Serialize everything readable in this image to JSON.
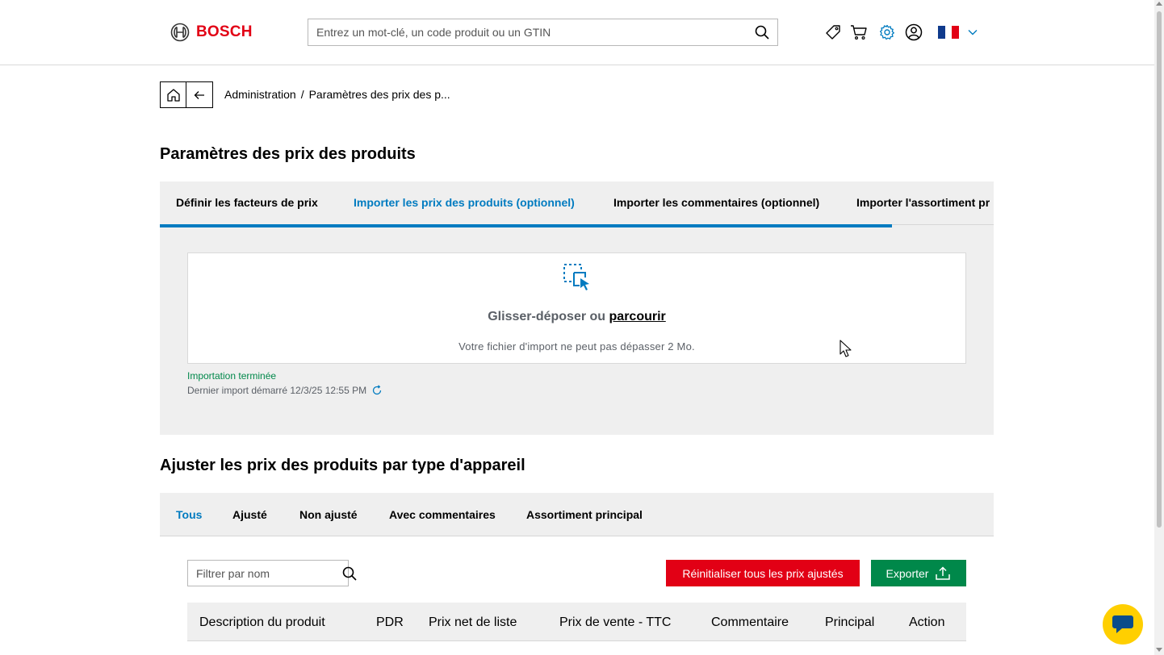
{
  "header": {
    "brand": "BOSCH",
    "search_placeholder": "Entrez un mot-clé, un code produit ou un GTIN",
    "colors": {
      "brand_red": "#e20015",
      "accent_blue": "#007bc0"
    }
  },
  "breadcrumb": {
    "items": [
      "Administration",
      "Paramètres des prix des p..."
    ],
    "separator": "/"
  },
  "page": {
    "title": "Paramètres des prix des produits"
  },
  "tabs": [
    {
      "label": "Définir les facteurs de prix",
      "active": false
    },
    {
      "label": "Importer les prix des produits (optionnel)",
      "active": true
    },
    {
      "label": "Importer les commentaires (optionnel)",
      "active": false
    },
    {
      "label": "Importer l'assortiment pr",
      "active": false
    }
  ],
  "upload": {
    "drag_text": "Glisser-déposer ou",
    "browse_link": "parcourir",
    "hint": "Votre fichier d'import ne peut pas dépasser 2 Mo.",
    "status": "Importation terminée",
    "last_import": "Dernier import démarré 12/3/25 12:55 PM"
  },
  "section": {
    "title": "Ajuster les prix des produits par type d'appareil"
  },
  "filter_tabs": [
    {
      "label": "Tous",
      "active": true
    },
    {
      "label": "Ajusté",
      "active": false
    },
    {
      "label": "Non ajusté",
      "active": false
    },
    {
      "label": "Avec commentaires",
      "active": false
    },
    {
      "label": "Assortiment principal",
      "active": false
    }
  ],
  "toolbar": {
    "filter_placeholder": "Filtrer par nom",
    "reset_label": "Réinitialiser tous les prix ajustés",
    "export_label": "Exporter"
  },
  "table": {
    "columns": [
      "Description du produit",
      "PDR",
      "Prix net de liste",
      "Prix de vente - TTC",
      "Commentaire",
      "Principal",
      "Action"
    ]
  }
}
